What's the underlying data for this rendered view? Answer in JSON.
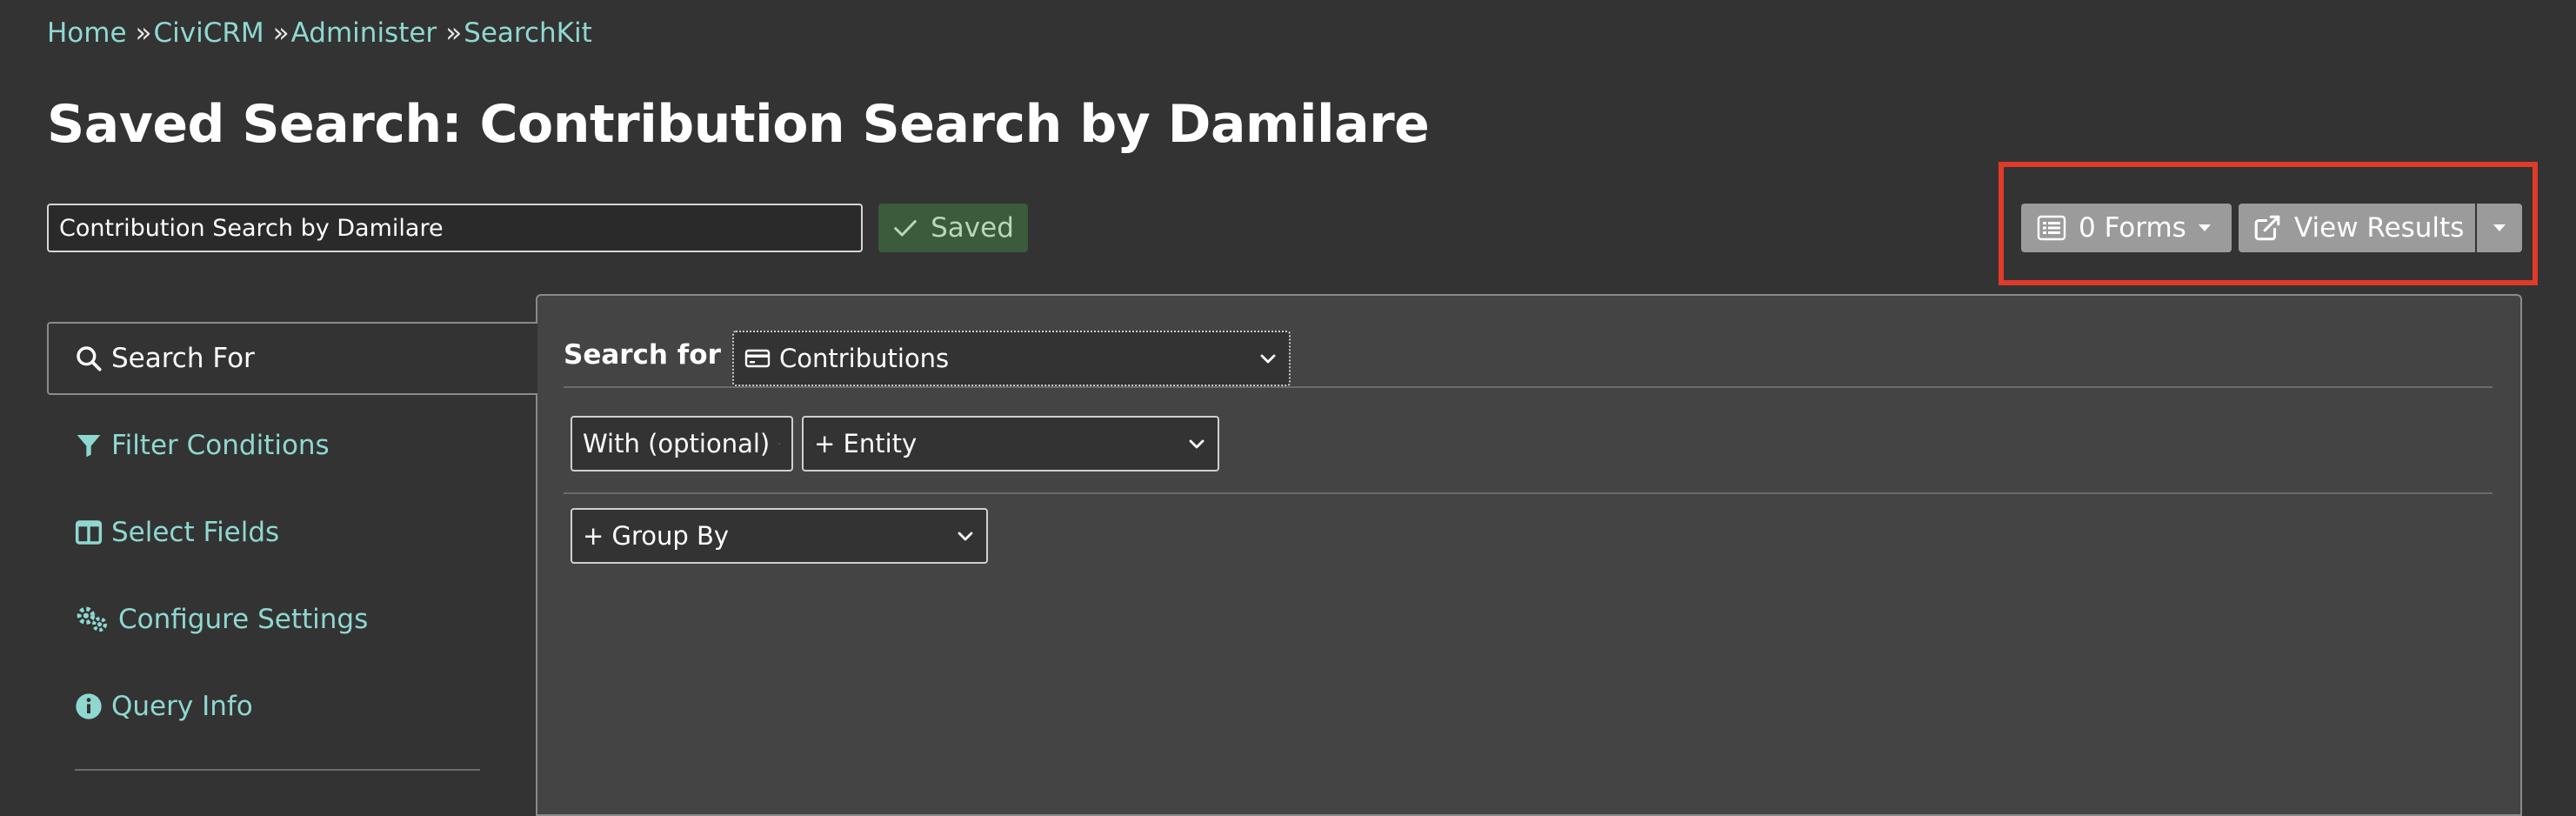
{
  "breadcrumb": {
    "items": [
      "Home",
      "CiviCRM",
      "Administer",
      "SearchKit"
    ],
    "separator": "»"
  },
  "page": {
    "title": "Saved Search: Contribution Search by Damilare"
  },
  "search_name": {
    "value": "Contribution Search by Damilare"
  },
  "status": {
    "saved_label": "Saved"
  },
  "toolbar": {
    "forms_label": "0 Forms",
    "view_results_label": "View Results"
  },
  "sidebar": {
    "items": [
      {
        "label": "Search For",
        "icon": "search-icon",
        "active": true
      },
      {
        "label": "Filter Conditions",
        "icon": "filter-icon"
      },
      {
        "label": "Select Fields",
        "icon": "columns-icon"
      },
      {
        "label": "Configure Settings",
        "icon": "gears-icon"
      },
      {
        "label": "Query Info",
        "icon": "info-icon"
      }
    ]
  },
  "main": {
    "search_for_label": "Search for",
    "entity_select": {
      "value": "Contributions",
      "icon": "credit-card-icon"
    },
    "with_select": {
      "value": "With (optional)"
    },
    "entity_join_select": {
      "value": "+ Entity"
    },
    "group_by_select": {
      "value": "+ Group By"
    }
  },
  "colors": {
    "background": "#333333",
    "panel": "#444444",
    "link": "#8fd8d0",
    "button": "#9b9b9b",
    "highlight": "#e03a28",
    "saved_badge": "#3c5a3c"
  }
}
